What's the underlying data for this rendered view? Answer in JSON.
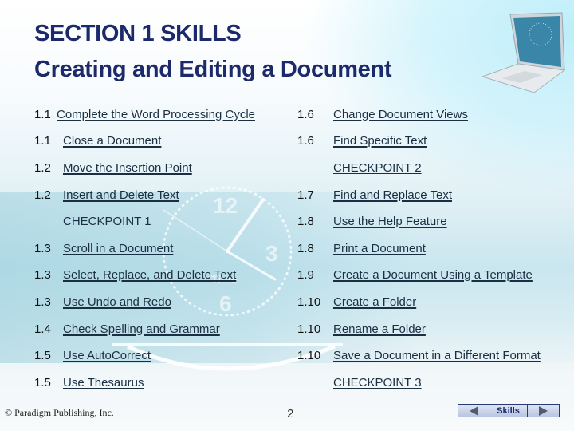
{
  "title": {
    "line1": "SECTION 1 SKILLS",
    "line2": "Creating and Editing a Document"
  },
  "left_column": [
    {
      "number": "1.1",
      "label": "Complete the Word Processing Cycle"
    },
    {
      "number": "1.1",
      "label": "Close a Document"
    },
    {
      "number": "1.2",
      "label": "Move the Insertion Point"
    },
    {
      "number": "1.2",
      "label": "Insert and Delete Text"
    },
    {
      "number": "",
      "label": "CHECKPOINT 1"
    },
    {
      "number": "1.3",
      "label": "Scroll in a Document"
    },
    {
      "number": "1.3",
      "label": "Select, Replace, and Delete Text"
    },
    {
      "number": "1.3",
      "label": "Use Undo and Redo"
    },
    {
      "number": "1.4",
      "label": "Check Spelling and Grammar"
    },
    {
      "number": "1.5",
      "label": "Use AutoCorrect"
    },
    {
      "number": "1.5",
      "label": "Use Thesaurus"
    }
  ],
  "right_column": [
    {
      "number": "1.6",
      "label": "Change Document Views"
    },
    {
      "number": "1.6",
      "label": "Find Specific Text"
    },
    {
      "number": "",
      "label": "CHECKPOINT 2"
    },
    {
      "number": "1.7",
      "label": "Find and Replace Text"
    },
    {
      "number": "1.8",
      "label": "Use the Help Feature"
    },
    {
      "number": "1.8",
      "label": "Print a Document"
    },
    {
      "number": "1.9",
      "label": "Create a Document Using a Template"
    },
    {
      "number": "1.10",
      "label": "Create a Folder"
    },
    {
      "number": "1.10",
      "label": "Rename a Folder"
    },
    {
      "number": "1.10",
      "label": "Save a Document in a Different Format"
    },
    {
      "number": "",
      "label": "CHECKPOINT 3"
    }
  ],
  "footer": {
    "copyright": "© Paradigm Publishing, Inc.",
    "page_number": "2",
    "nav": {
      "prev_icon": "triangle-left",
      "center_label": "Skills",
      "next_icon": "triangle-right"
    }
  },
  "colors": {
    "title": "#1c2a6b",
    "link": "#1b2f42",
    "nav_border": "#2b3a73"
  }
}
